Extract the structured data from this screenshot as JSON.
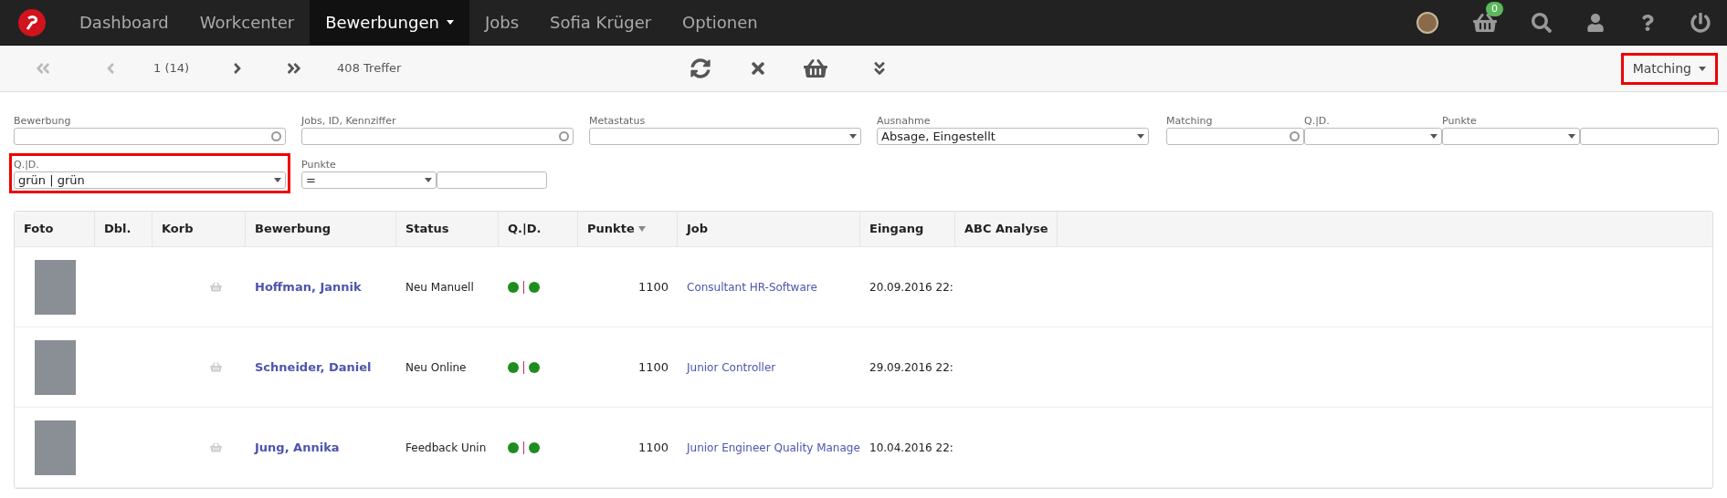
{
  "nav": {
    "items": [
      {
        "label": "Dashboard",
        "selected": false,
        "dropdown": false
      },
      {
        "label": "Workcenter",
        "selected": false,
        "dropdown": false
      },
      {
        "label": "Bewerbungen",
        "selected": true,
        "dropdown": true
      },
      {
        "label": "Jobs",
        "selected": false,
        "dropdown": false
      },
      {
        "label": "Sofia Krüger",
        "selected": false,
        "dropdown": false
      },
      {
        "label": "Optionen",
        "selected": false,
        "dropdown": false
      }
    ],
    "cart_count": "0"
  },
  "toolbar": {
    "page": "1 (14)",
    "hits": "408 Treffer",
    "view": {
      "label": "Matching",
      "highlighted": true
    }
  },
  "filters": {
    "row1": [
      {
        "kind": "search",
        "label": "Bewerbung"
      },
      {
        "kind": "search",
        "label": "Jobs, ID, Kennziffer"
      },
      {
        "kind": "select",
        "label": "Metastatus"
      },
      {
        "kind": "select",
        "label": "Ausnahme",
        "value": "Absage, Eingestellt"
      },
      {
        "kind": "search-small",
        "label": "Matching"
      },
      {
        "kind": "select-small",
        "label": "Q.|D."
      },
      {
        "kind": "select-small",
        "label": "Punkte"
      },
      {
        "kind": "text-small"
      }
    ],
    "row2": [
      {
        "kind": "select",
        "label": "Q.|D.",
        "value": "grün | grün",
        "highlighted": true
      },
      {
        "kind": "compare",
        "label": "Punkte",
        "value": "=",
        "highlighted": false
      }
    ]
  },
  "table": {
    "columns": [
      {
        "label": "Foto",
        "sorted": false
      },
      {
        "label": "Dbl.",
        "sorted": false
      },
      {
        "label": "Korb",
        "sorted": false
      },
      {
        "label": "Bewerbung",
        "sorted": false
      },
      {
        "label": "Status",
        "sorted": false
      },
      {
        "label": "Q.|D.",
        "sorted": false
      },
      {
        "label": "Punkte",
        "sorted": true
      },
      {
        "label": "Job",
        "sorted": false
      },
      {
        "label": "Eingang",
        "sorted": false
      },
      {
        "label": "ABC Analyse",
        "sorted": false
      }
    ],
    "rows": [
      {
        "name": "Hoffman, Jannik",
        "status": "Neu Manuell",
        "dots": [
          {
            "color": "#1e8c1e"
          },
          {
            "color": "#1e8c1e"
          }
        ],
        "points": "1100",
        "job": "Consultant HR-Software",
        "received": "20.09.2016 22:"
      },
      {
        "name": "Schneider, Daniel",
        "status": "Neu Online",
        "dots": [
          {
            "color": "#1e8c1e"
          },
          {
            "color": "#1e8c1e"
          }
        ],
        "points": "1100",
        "job": "Junior Controller",
        "received": "29.09.2016 22:"
      },
      {
        "name": "Jung, Annika",
        "status": "Feedback Unin",
        "dots": [
          {
            "color": "#1e8c1e"
          },
          {
            "color": "#1e8c1e"
          }
        ],
        "points": "1100",
        "job": "Junior Engineer Quality Manage",
        "received": "10.04.2016 22:"
      }
    ]
  }
}
